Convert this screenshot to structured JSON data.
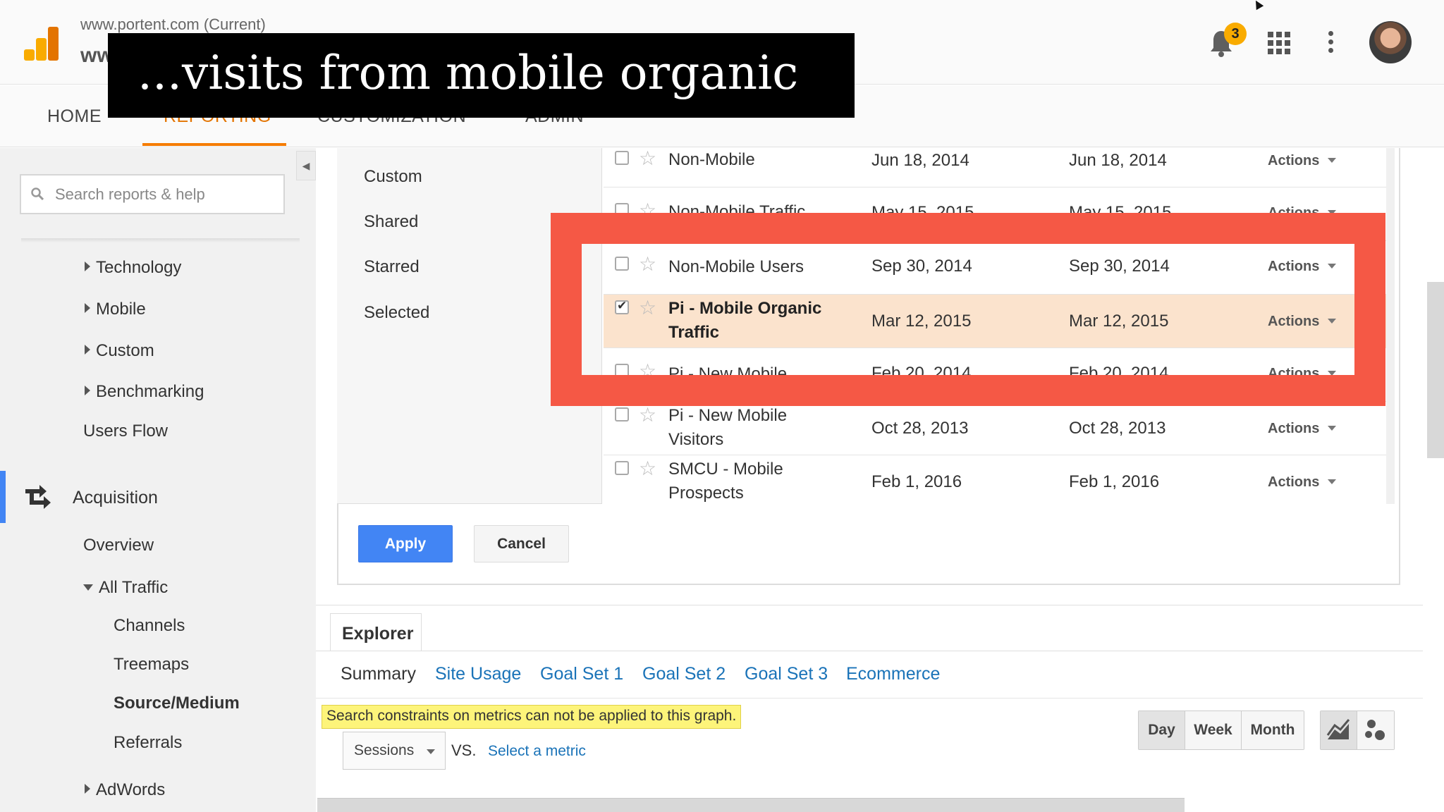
{
  "header": {
    "property": "www.portent.com (Current)",
    "view_name": "www",
    "notification_count": "3"
  },
  "nav": {
    "home": "HOME",
    "reporting": "REPORTING",
    "customization": "CUSTOMIZATION",
    "admin": "ADMIN"
  },
  "caption": "...visits from mobile organic",
  "sidebar": {
    "search_placeholder": "Search reports & help",
    "items": {
      "technology": "Technology",
      "mobile": "Mobile",
      "custom": "Custom",
      "benchmarking": "Benchmarking",
      "users_flow": "Users Flow",
      "acquisition": "Acquisition",
      "overview": "Overview",
      "all_traffic": "All Traffic",
      "channels": "Channels",
      "treemaps": "Treemaps",
      "source_medium": "Source/Medium",
      "referrals": "Referrals",
      "adwords": "AdWords"
    }
  },
  "segments": {
    "filters": [
      "Custom",
      "Shared",
      "Starred",
      "Selected"
    ],
    "actions_label": "Actions",
    "rows": [
      {
        "name": "Non-Mobile",
        "created": "Jun 18, 2014",
        "modified": "Jun 18, 2014",
        "checked": false
      },
      {
        "name": "Non-Mobile Traffic",
        "created": "May 15, 2015",
        "modified": "May 15, 2015",
        "checked": false
      },
      {
        "name": "Non-Mobile Users",
        "created": "Sep 30, 2014",
        "modified": "Sep 30, 2014",
        "checked": false
      },
      {
        "name": "Pi - Mobile Organic Traffic",
        "created": "Mar 12, 2015",
        "modified": "Mar 12, 2015",
        "checked": true
      },
      {
        "name": "Pi - New Mobile",
        "created": "Feb 20, 2014",
        "modified": "Feb 20, 2014",
        "checked": false
      },
      {
        "name": "Pi - New Mobile Visitors",
        "created": "Oct 28, 2013",
        "modified": "Oct 28, 2013",
        "checked": false
      },
      {
        "name": "SMCU - Mobile Prospects",
        "created": "Feb 1, 2016",
        "modified": "Feb 1, 2016",
        "checked": false
      }
    ],
    "apply_label": "Apply",
    "cancel_label": "Cancel"
  },
  "explorer": {
    "tab_label": "Explorer",
    "subtabs": [
      "Summary",
      "Site Usage",
      "Goal Set 1",
      "Goal Set 2",
      "Goal Set 3",
      "Ecommerce"
    ],
    "notice": "Search constraints on metrics can not be applied to this graph.",
    "metric": "Sessions",
    "vs_label": "VS.",
    "select_metric": "Select a metric",
    "periods": [
      "Day",
      "Week",
      "Month"
    ],
    "active_period": "Day"
  },
  "colors": {
    "accent_blue": "#4285f4",
    "highlight_red": "#f55845",
    "reporting_orange": "#e37400",
    "selected_row": "#fbe3cd"
  }
}
